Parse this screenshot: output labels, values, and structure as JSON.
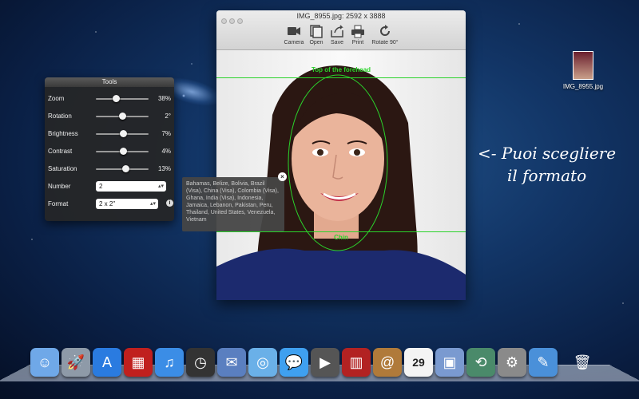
{
  "window": {
    "title": "IMG_8955.jpg: 2592 x 3888",
    "toolbar": [
      {
        "label": "Camera",
        "icon": "camera-icon"
      },
      {
        "label": "Open",
        "icon": "open-icon"
      },
      {
        "label": "Save",
        "icon": "save-icon"
      },
      {
        "label": "Print",
        "icon": "print-icon"
      },
      {
        "label": "Rotate 90°",
        "icon": "rotate-icon"
      }
    ],
    "guides": {
      "top_label": "Top of the forehead",
      "bottom_label": "Chin"
    }
  },
  "tools": {
    "title": "Tools",
    "sliders": [
      {
        "label": "Zoom",
        "value": "38%",
        "level": 0.38
      },
      {
        "label": "Rotation",
        "value": "2°",
        "level": 0.5
      },
      {
        "label": "Brightness",
        "value": "7%",
        "level": 0.52
      },
      {
        "label": "Contrast",
        "value": "4%",
        "level": 0.51
      },
      {
        "label": "Saturation",
        "value": "13%",
        "level": 0.56
      }
    ],
    "number": {
      "label": "Number",
      "value": "2"
    },
    "format": {
      "label": "Format",
      "value": "2 x 2\""
    }
  },
  "tooltip": {
    "text": "Bahamas, Belize, Bolivia, Brazil (Visa), China (Visa), Colombia (Visa), Ghana, India (Visa), Indonesia, Jamaica, Lebanon, Pakistan, Peru, Thailand, United States, Venezuela, Vietnam"
  },
  "desktop": {
    "file_icon_label": "IMG_8955.jpg",
    "annotation_line1": "<- Puoi scegliere",
    "annotation_line2": "il formato"
  },
  "dock": {
    "items": [
      {
        "name": "finder-icon",
        "glyph": "☺",
        "bg": "#6fa8e8"
      },
      {
        "name": "launchpad-icon",
        "glyph": "🚀",
        "bg": "#8e9aa8"
      },
      {
        "name": "app-store-icon",
        "glyph": "A",
        "bg": "#2a7be0"
      },
      {
        "name": "photo-booth-icon",
        "glyph": "▦",
        "bg": "#c0201e"
      },
      {
        "name": "itunes-icon",
        "glyph": "♫",
        "bg": "#3b8de6"
      },
      {
        "name": "dashboard-icon",
        "glyph": "◷",
        "bg": "#333333"
      },
      {
        "name": "mail-icon",
        "glyph": "✉",
        "bg": "#5a7fc0"
      },
      {
        "name": "safari-icon",
        "glyph": "◎",
        "bg": "#6ab0e8"
      },
      {
        "name": "messages-icon",
        "glyph": "💬",
        "bg": "#3fa0f0"
      },
      {
        "name": "facetime-icon",
        "glyph": "▶",
        "bg": "#555555"
      },
      {
        "name": "photo-booth-2-icon",
        "glyph": "▥",
        "bg": "#b22222"
      },
      {
        "name": "address-book-icon",
        "glyph": "@",
        "bg": "#b07a3a"
      },
      {
        "name": "calendar-icon",
        "glyph": "29",
        "bg": "#f4f4f4"
      },
      {
        "name": "iphoto-icon",
        "glyph": "▣",
        "bg": "#7a9ad0"
      },
      {
        "name": "time-machine-icon",
        "glyph": "⟲",
        "bg": "#4a8a6a"
      },
      {
        "name": "system-preferences-icon",
        "glyph": "⚙",
        "bg": "#8a8a8a"
      },
      {
        "name": "xcode-icon",
        "glyph": "✎",
        "bg": "#4a90d9"
      },
      {
        "name": "trash-icon",
        "glyph": "🗑",
        "bg": "transparent"
      }
    ]
  }
}
